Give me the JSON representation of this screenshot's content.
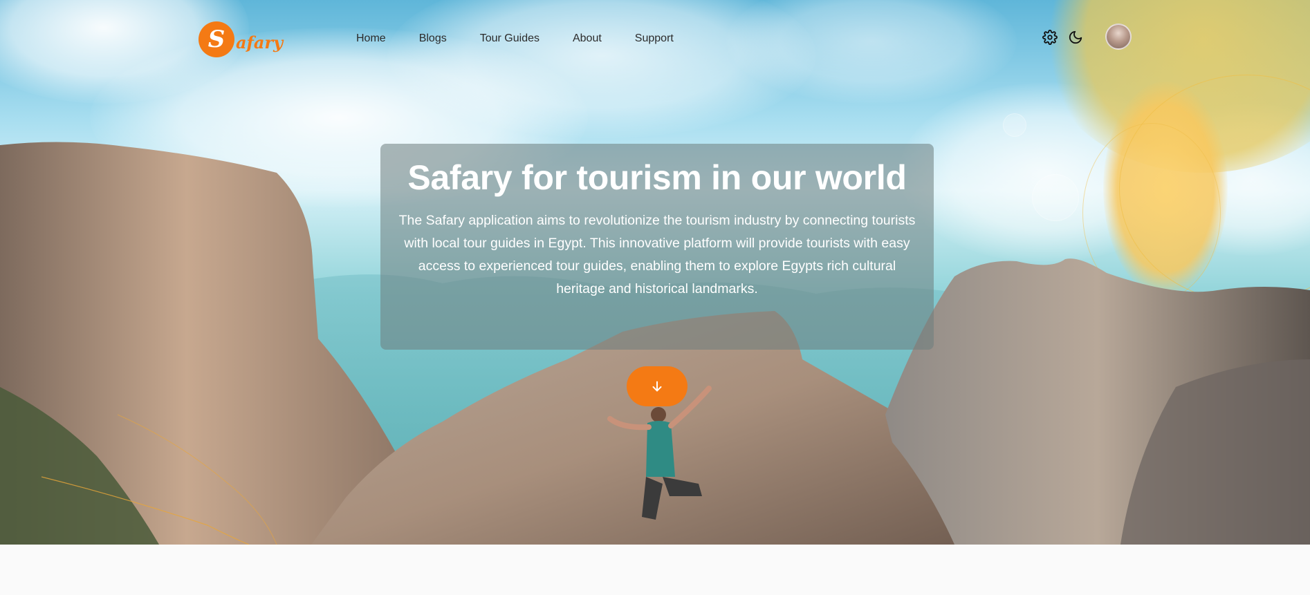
{
  "brand": {
    "logo_letter": "S",
    "logo_text": "afary",
    "accent": "#f47a14"
  },
  "nav": {
    "items": [
      {
        "label": "Home"
      },
      {
        "label": "Blogs"
      },
      {
        "label": "Tour Guides"
      },
      {
        "label": "About"
      },
      {
        "label": "Support"
      }
    ],
    "icons": [
      "gear-icon",
      "moon-icon"
    ]
  },
  "hero": {
    "title": "Safary for tourism in our world",
    "description": "The Safary application aims to revolutionize the tourism industry by connecting tourists with local tour guides in Egypt. This innovative platform will provide tourists with easy access to experienced tour guides, enabling them to explore Egypts rich cultural heritage and historical landmarks.",
    "cta_icon": "arrow-down-icon"
  }
}
